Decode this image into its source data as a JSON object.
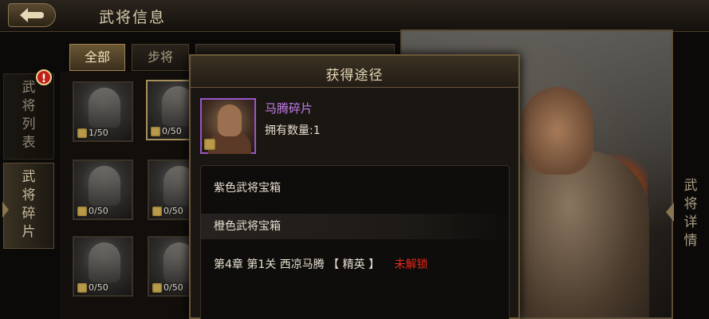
{
  "header": {
    "title": "武将信息",
    "back_icon": "back-arrow-icon"
  },
  "left_tabs": [
    {
      "label": [
        "武",
        "将",
        "列",
        "表"
      ],
      "badge": "!"
    },
    {
      "label": [
        "武",
        "将",
        "碎",
        "片"
      ]
    }
  ],
  "filter_tabs": [
    "全部",
    "步将"
  ],
  "grid": {
    "cells": [
      {
        "count": "1/50"
      },
      {
        "count": "0/50"
      },
      {
        "count": "0/50"
      },
      {
        "count": "0/50"
      },
      {
        "count": "0/50"
      },
      {
        "count": "0/50"
      }
    ]
  },
  "right_tab": {
    "label": [
      "武",
      "将",
      "详",
      "情"
    ]
  },
  "modal": {
    "title": "获得途径",
    "item_name": "马腾碎片",
    "item_owned": "拥有数量:1",
    "sources": [
      {
        "text": "紫色武将宝箱"
      },
      {
        "text": "橙色武将宝箱"
      },
      {
        "text": "第4章 第1关 西凉马腾 【 精英 】",
        "status": "未解锁"
      }
    ]
  },
  "colors": {
    "purple_rarity": "#9a55c8",
    "locked_red": "#e02a1a",
    "gold_border": "#a08450"
  }
}
